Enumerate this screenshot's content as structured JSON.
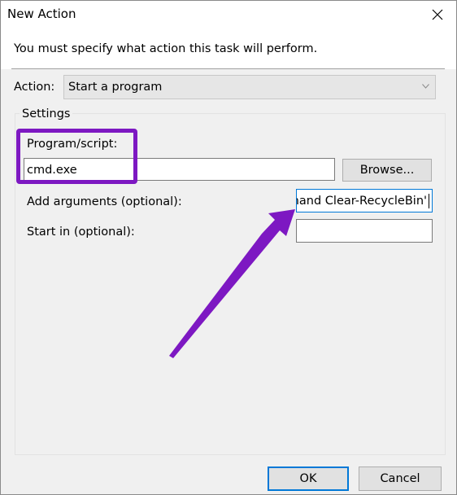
{
  "window": {
    "title": "New Action",
    "close_icon": "close-icon"
  },
  "header": {
    "message": "You must specify what action this task will perform."
  },
  "action": {
    "label": "Action:",
    "selected": "Start a program"
  },
  "settings": {
    "legend": "Settings",
    "program_script": {
      "label": "Program/script:",
      "value": "cmd.exe"
    },
    "browse_button": "Browse...",
    "add_arguments": {
      "label": "Add arguments (optional):",
      "value": "nmand Clear-RecycleBin'"
    },
    "start_in": {
      "label": "Start in (optional):",
      "value": ""
    }
  },
  "buttons": {
    "ok": "OK",
    "cancel": "Cancel"
  },
  "colors": {
    "annotation": "#7d18c2",
    "focus_border": "#0078d7"
  }
}
